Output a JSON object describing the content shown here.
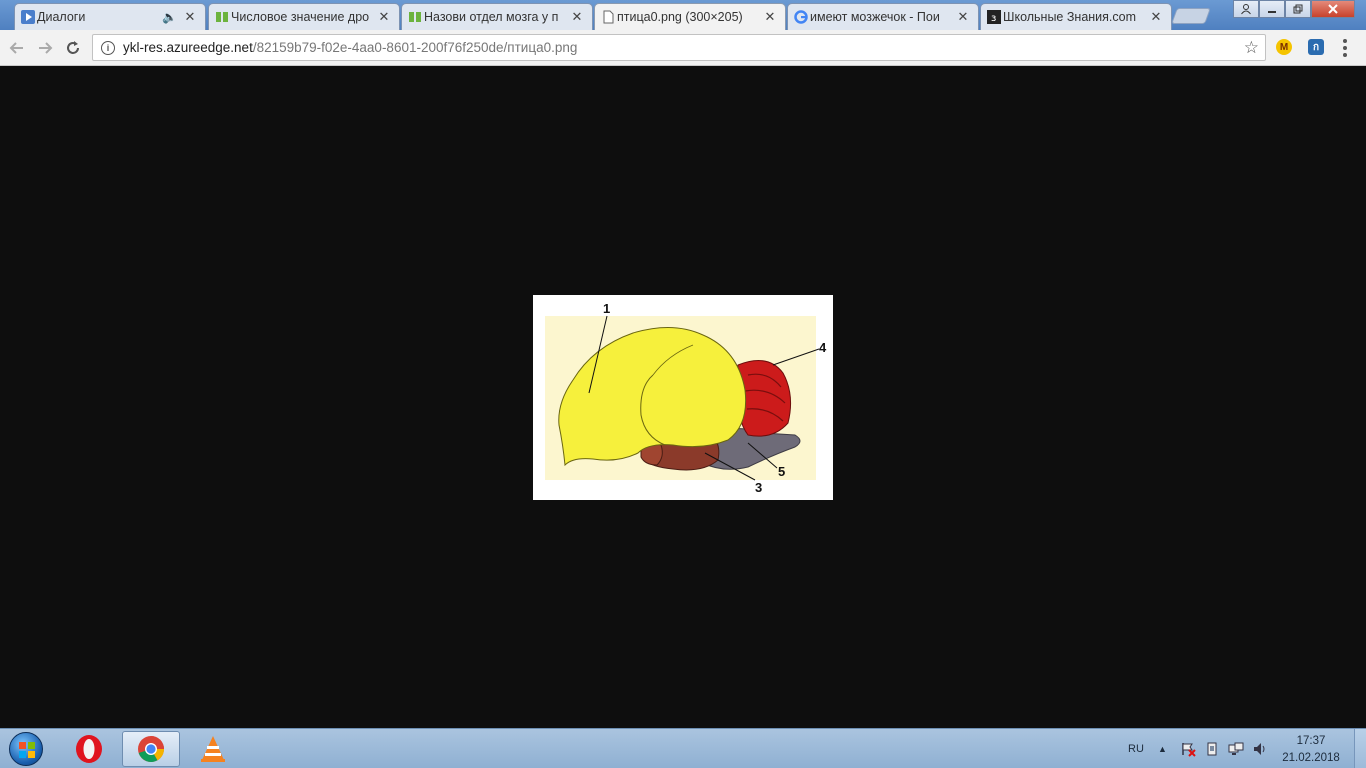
{
  "tabs": [
    {
      "title": "Диалоги",
      "favicon": "play-icon",
      "has_audio": true
    },
    {
      "title": "Числовое значение дро",
      "favicon": "green-book-icon",
      "has_audio": false
    },
    {
      "title": "Назови отдел мозга у п",
      "favicon": "green-book-icon",
      "has_audio": false
    },
    {
      "title": "птица0.png (300×205)",
      "favicon": "document-icon",
      "has_audio": false,
      "active": true
    },
    {
      "title": "имеют мозжечок - Пои",
      "favicon": "google-icon",
      "has_audio": false
    },
    {
      "title": "Школьные Знания.com",
      "favicon": "znanija-icon",
      "has_audio": false
    }
  ],
  "close_glyph": "✕",
  "address_bar": {
    "host": "ykl-res.azureedge.net",
    "path": "/82159b79-f02e-4aa0-8601-200f76f250de/птица0.png"
  },
  "extensions": [
    {
      "name": "m-extension-icon",
      "label": "M",
      "color": "#f5c400"
    },
    {
      "name": "blue-extension-icon",
      "label": "ก",
      "color": "#2b6cb0"
    }
  ],
  "image": {
    "labels": [
      "1",
      "4",
      "5",
      "3"
    ],
    "colors": {
      "cerebrum": "#f6f03c",
      "cerebellum": "#cc1b1b",
      "midbrain": "#8b3a2a",
      "medulla": "#6e6b78",
      "bg": "#fcf6cf"
    }
  },
  "taskbar": {
    "language": "RU",
    "time": "17:37",
    "date": "21.02.2018",
    "apps": [
      "opera-icon",
      "chrome-icon",
      "vlc-icon"
    ]
  }
}
